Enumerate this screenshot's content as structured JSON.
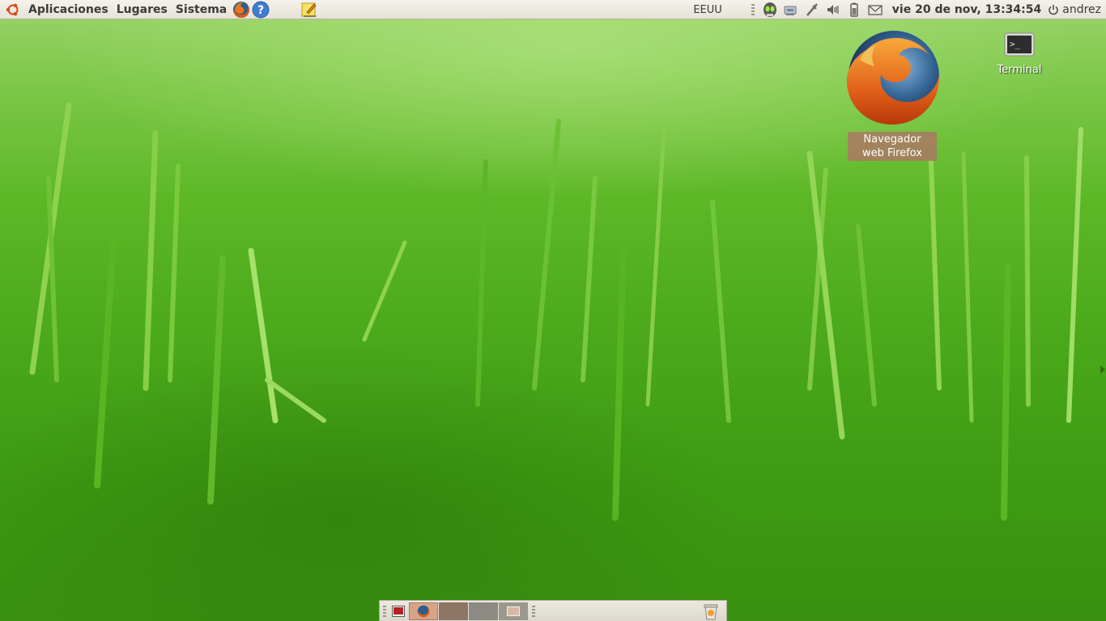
{
  "top_panel": {
    "menus": [
      "Aplicaciones",
      "Lugares",
      "Sistema"
    ],
    "keyboard_layout": "EEUU",
    "clock": "vie 20 de nov, 13:34:54",
    "user": "andrez"
  },
  "desktop": {
    "icons": [
      {
        "label": "Navegador web Firefox",
        "icon": "firefox-icon"
      },
      {
        "label": "Terminal",
        "icon": "terminal-icon"
      }
    ]
  },
  "bottom_panel": {
    "tasks": [
      "show-desktop",
      "firefox",
      "workspace-1",
      "workspace-2",
      "workspace-3"
    ],
    "trash_icon": "trash-icon"
  },
  "colors": {
    "panel": "#e6e2d8",
    "grass": "#4aa81a",
    "firefox_label_bg": "#aa7864"
  }
}
